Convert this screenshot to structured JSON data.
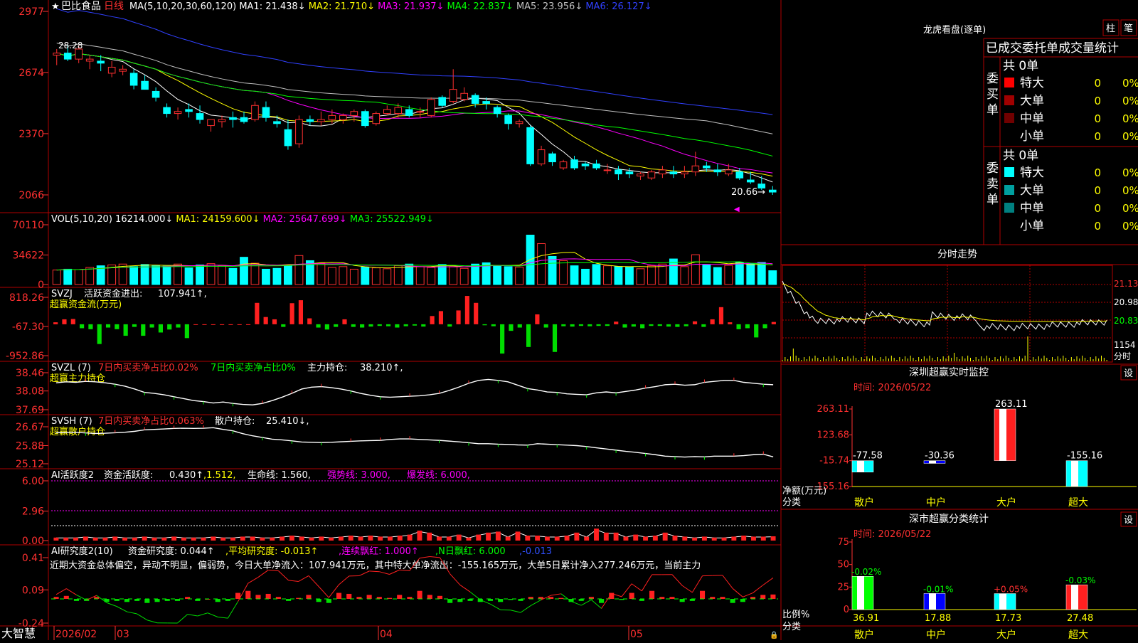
{
  "app": {
    "brand": "大智慧"
  },
  "chart_data": [
    {
      "type": "candlestick",
      "title": "巴比食品",
      "period": "日线",
      "ma_formula": "MA(5,10,20,30,60,120)",
      "ma_values": [
        {
          "label": "MA1:",
          "value": "21.438↓",
          "color": "#ffffff"
        },
        {
          "label": "MA2:",
          "value": "21.710↓",
          "color": "#ffff00"
        },
        {
          "label": "MA3:",
          "value": "21.937↓",
          "color": "#ff00ff"
        },
        {
          "label": "MA4:",
          "value": "22.837↓",
          "color": "#00ff00"
        },
        {
          "label": "MA5:",
          "value": "23.956↓",
          "color": "#c0c0c0"
        },
        {
          "label": "MA6:",
          "value": "26.127↓",
          "color": "#3040ff"
        }
      ],
      "y_ticks": [
        "2977",
        "2674",
        "2370",
        "2066"
      ],
      "ylim": [
        20.66,
        29.77
      ],
      "annotations": {
        "high": "28.28",
        "low": "20.66→"
      },
      "x_labels": [
        "2026/02",
        "03",
        "04",
        "05"
      ],
      "candles": [
        [
          27.6,
          27.9,
          27.1,
          27.7
        ],
        [
          27.7,
          28.1,
          27.3,
          27.4
        ],
        [
          27.4,
          28.1,
          27.2,
          27.9
        ],
        [
          27.3,
          27.6,
          26.9,
          27.4
        ],
        [
          27.3,
          27.6,
          26.8,
          27.2
        ],
        [
          26.7,
          27.3,
          26.5,
          27.0
        ],
        [
          26.8,
          27.1,
          26.6,
          26.9
        ],
        [
          26.7,
          26.9,
          25.9,
          26.1
        ],
        [
          26.3,
          26.6,
          25.9,
          25.9
        ],
        [
          25.8,
          26.0,
          25.3,
          25.5
        ],
        [
          25.0,
          25.2,
          24.5,
          24.7
        ],
        [
          24.7,
          25.0,
          24.4,
          24.8
        ],
        [
          24.9,
          25.2,
          24.5,
          24.8
        ],
        [
          24.7,
          25.1,
          24.2,
          24.4
        ],
        [
          24.1,
          24.4,
          23.8,
          24.4
        ],
        [
          24.3,
          24.6,
          24.0,
          24.4
        ],
        [
          24.5,
          24.8,
          24.0,
          24.4
        ],
        [
          24.5,
          24.8,
          24.2,
          24.3
        ],
        [
          24.4,
          25.3,
          24.3,
          25.1
        ],
        [
          25.0,
          25.3,
          24.3,
          24.5
        ],
        [
          24.3,
          24.6,
          24.0,
          24.2
        ],
        [
          23.9,
          24.4,
          22.9,
          23.1
        ],
        [
          23.2,
          24.6,
          23.0,
          24.4
        ],
        [
          24.4,
          24.6,
          24.1,
          24.3
        ],
        [
          24.3,
          24.8,
          24.1,
          24.4
        ],
        [
          24.4,
          24.9,
          24.2,
          24.6
        ],
        [
          24.4,
          24.7,
          24.2,
          24.6
        ],
        [
          24.6,
          24.9,
          24.3,
          24.8
        ],
        [
          24.8,
          24.9,
          24.0,
          24.1
        ],
        [
          24.2,
          24.8,
          24.1,
          24.7
        ],
        [
          24.7,
          25.1,
          24.6,
          24.9
        ],
        [
          24.7,
          25.2,
          24.5,
          25.0
        ],
        [
          24.9,
          25.1,
          24.5,
          24.6
        ],
        [
          24.8,
          25.0,
          24.5,
          24.8
        ],
        [
          24.6,
          25.5,
          24.5,
          25.4
        ],
        [
          25.5,
          25.6,
          25.0,
          25.1
        ],
        [
          25.3,
          26.9,
          25.2,
          25.9
        ],
        [
          25.4,
          26.0,
          25.3,
          25.7
        ],
        [
          25.6,
          25.7,
          25.0,
          25.2
        ],
        [
          25.3,
          25.5,
          24.9,
          25.2
        ],
        [
          25.0,
          25.1,
          24.5,
          24.7
        ],
        [
          24.6,
          24.7,
          23.9,
          24.2
        ],
        [
          24.2,
          24.4,
          24.0,
          24.3
        ],
        [
          24.0,
          24.1,
          22.1,
          22.2
        ],
        [
          22.2,
          23.1,
          22.1,
          22.9
        ],
        [
          22.7,
          22.8,
          22.1,
          22.3
        ],
        [
          22.0,
          22.4,
          21.9,
          22.3
        ],
        [
          22.4,
          22.6,
          21.9,
          22.0
        ],
        [
          22.2,
          22.3,
          21.9,
          22.1
        ],
        [
          22.2,
          22.4,
          21.9,
          22.0
        ],
        [
          21.9,
          22.2,
          21.7,
          21.9
        ],
        [
          21.9,
          22.1,
          21.4,
          21.7
        ],
        [
          21.8,
          22.0,
          21.5,
          21.7
        ],
        [
          21.6,
          21.8,
          21.4,
          21.7
        ],
        [
          21.5,
          21.9,
          21.4,
          21.8
        ],
        [
          21.7,
          22.1,
          21.5,
          21.9
        ],
        [
          21.8,
          22.1,
          21.5,
          21.7
        ],
        [
          21.7,
          22.1,
          21.5,
          21.8
        ],
        [
          21.8,
          22.8,
          21.6,
          22.1
        ],
        [
          22.1,
          22.3,
          21.8,
          22.0
        ],
        [
          21.9,
          22.2,
          21.6,
          21.8
        ],
        [
          21.7,
          22.2,
          21.6,
          21.9
        ],
        [
          21.8,
          22.0,
          21.4,
          21.5
        ],
        [
          21.4,
          21.8,
          21.2,
          21.3
        ],
        [
          21.2,
          21.6,
          20.9,
          21.0
        ],
        [
          20.9,
          21.1,
          20.66,
          20.8
        ]
      ]
    },
    {
      "type": "bar",
      "title": "VOL(5,10,20)",
      "values_text": [
        {
          "label": "",
          "value": "16214.000↓",
          "color": "#ffffff"
        },
        {
          "label": "MA1:",
          "value": "24159.600↓",
          "color": "#ffff00"
        },
        {
          "label": "MA2:",
          "value": "25647.699↓",
          "color": "#ff00ff"
        },
        {
          "label": "MA3:",
          "value": "25522.949↓",
          "color": "#00ff00"
        }
      ],
      "y_ticks": [
        "70110",
        "34622",
        "0"
      ],
      "ylim": [
        0,
        70110
      ],
      "values": [
        17000,
        18000,
        17500,
        20000,
        22000,
        23000,
        24000,
        21000,
        23500,
        22000,
        21500,
        24000,
        19500,
        23000,
        24500,
        22000,
        19000,
        32000,
        25000,
        18000,
        19000,
        22500,
        34000,
        28000,
        25000,
        20000,
        21000,
        18000,
        20500,
        19500,
        18500,
        22000,
        24000,
        21000,
        20000,
        23500,
        21000,
        19000,
        24000,
        25500,
        22000,
        21000,
        20500,
        58000,
        48000,
        33000,
        28000,
        22000,
        18000,
        23500,
        22000,
        21000,
        20500,
        18500,
        22000,
        24000,
        30000,
        21000,
        35000,
        23000,
        20000,
        22500,
        26000,
        24500,
        26000,
        16214
      ],
      "up_down": "per-candle"
    },
    {
      "type": "bar",
      "title": "SVZJ",
      "label_text": "活跃资金进出:",
      "value_text": "107.941↑,",
      "sub_label": "超赢资金流(万元)",
      "y_ticks": [
        "818.26",
        "-67.30",
        "-952.86"
      ],
      "ylim": [
        -952.86,
        818.26
      ],
      "values": [
        60,
        150,
        160,
        -120,
        -150,
        -600,
        -100,
        -150,
        -350,
        -80,
        -350,
        -100,
        -250,
        -160,
        -100,
        -420,
        0,
        0,
        0,
        0,
        0,
        0,
        0,
        650,
        220,
        150,
        -80,
        640,
        730,
        180,
        -100,
        -160,
        -80,
        150,
        -80,
        -100,
        -70,
        -50,
        -60,
        -100,
        -60,
        -40,
        -70,
        250,
        400,
        -70,
        420,
        860,
        650,
        -30,
        -60,
        -890,
        -200,
        -100,
        -690,
        300,
        -100,
        -840,
        -60,
        -70,
        -50,
        -60,
        -50,
        -50,
        80,
        -100,
        -70,
        -120,
        -50,
        -50,
        -70,
        -80,
        -60,
        90,
        -80,
        150,
        520,
        60,
        -150,
        -120,
        -400,
        -120,
        70
      ]
    },
    {
      "type": "line",
      "title": "SVZL (7)",
      "label_text": "7日内买卖净占比0.02%",
      "label_text2": "7日内买卖净占比0%",
      "value_label": "主力持仓:",
      "value_text": "38.210↑,",
      "sub_label": "超赢主力持仓",
      "y_ticks": [
        "38.46",
        "38.08",
        "37.69"
      ],
      "ylim": [
        37.69,
        38.46
      ],
      "values": [
        38.25,
        38.27,
        38.26,
        38.28,
        38.27,
        38.25,
        38.22,
        38.18,
        38.12,
        38.05,
        38.03,
        38.0,
        37.96,
        37.92,
        37.88,
        37.86,
        37.83,
        37.85,
        37.82,
        37.8,
        37.79,
        37.82,
        37.88,
        37.95,
        38.03,
        38.12,
        38.16,
        38.17,
        38.15,
        38.12,
        38.08,
        38.03,
        37.99,
        37.96,
        37.95,
        37.96,
        37.97,
        37.98,
        38.0,
        38.03,
        38.09,
        38.16,
        38.24,
        38.3,
        38.32,
        38.3,
        38.27,
        38.2,
        38.13,
        38.1,
        38.06,
        38.05,
        38.02,
        38.01,
        38.0,
        38.04,
        38.06,
        38.04,
        38.07,
        38.1,
        38.14,
        38.17,
        38.21,
        38.22,
        38.2,
        38.21,
        38.26,
        38.28,
        38.3,
        38.3,
        38.26,
        38.24,
        38.22,
        38.21
      ]
    },
    {
      "type": "line",
      "title": "SVSH (7)",
      "label_text": "7日内买卖净占比0.063%",
      "value_label": "散户持仓:",
      "value_text": "25.410↓,",
      "sub_label": "超赢散户持仓",
      "y_ticks": [
        "26.67",
        "25.88",
        "25.12"
      ],
      "ylim": [
        25.12,
        26.67
      ],
      "values": [
        26.42,
        26.43,
        26.44,
        26.41,
        26.39,
        26.4,
        26.42,
        26.44,
        26.48,
        26.54,
        26.56,
        26.58,
        26.6,
        26.61,
        26.6,
        26.61,
        26.63,
        26.56,
        26.5,
        26.38,
        26.29,
        26.22,
        26.15,
        26.12,
        26.08,
        26.03,
        26.02,
        26.01,
        26.02,
        26.04,
        26.06,
        26.08,
        26.09,
        26.1,
        26.14,
        26.16,
        26.16,
        26.14,
        26.12,
        26.1,
        26.07,
        26.04,
        26.0,
        25.96,
        25.96,
        25.94,
        25.93,
        25.91,
        25.9,
        25.96,
        25.94,
        25.92,
        25.9,
        25.88,
        25.84,
        25.79,
        25.74,
        25.69,
        25.64,
        25.6,
        25.55,
        25.5,
        25.44,
        25.42,
        25.4,
        25.42,
        25.41,
        25.44,
        25.44,
        25.44,
        25.46,
        25.5,
        25.52,
        25.41
      ]
    },
    {
      "type": "bar",
      "title": "AI活跃度2",
      "label_text": "资金活跃度:",
      "value_text": "0.430↑",
      "extra": [
        {
          "text": ",1.512,",
          "color": "#ffff00"
        },
        {
          "text": "生命线: 1.560,",
          "color": "#ffffff"
        },
        {
          "text": "强势线: 3.000,",
          "color": "#ff00ff"
        },
        {
          "text": "爆发线: 6.000,",
          "color": "#ff00ff"
        }
      ],
      "y_ticks": [
        "6.00",
        "2.96",
        "0.00"
      ],
      "ylim": [
        0,
        6.0
      ],
      "values": [
        0.3,
        0.3,
        0.3,
        0.4,
        0.3,
        0.3,
        0.4,
        0.3,
        0.3,
        0.4,
        0.3,
        0.3,
        0.4,
        0.3,
        0.3,
        0.3,
        0.4,
        0.3,
        0.3,
        0.4,
        0.4,
        0.3,
        0.3,
        0.4,
        0.5,
        0.4,
        0.3,
        0.4,
        0.3,
        0.4,
        0.5,
        0.4,
        0.5,
        0.4,
        0.4,
        0.5,
        0.6,
        1.0,
        0.8,
        0.4,
        0.4,
        0.6,
        0.3,
        0.6,
        0.8,
        0.9,
        0.4,
        0.9,
        0.5,
        0.5,
        0.4,
        0.4,
        0.5,
        0.8,
        0.4,
        1.2,
        0.8,
        0.8,
        0.4,
        0.6,
        0.4,
        0.5,
        0.8,
        0.5,
        0.4,
        0.3,
        0.4,
        0.3,
        0.3,
        0.4,
        0.5,
        0.4,
        0.4,
        0.43
      ]
    },
    {
      "type": "bar",
      "title": "AI研究度2(10)",
      "label_text": "资金研究度: 0.044↑",
      "extra": [
        {
          "text": ",平均研究度: -0.013↑",
          "color": "#ffff00"
        },
        {
          "text": ",连续飘红: 1.000↑",
          "color": "#ff00ff"
        },
        {
          "text": ",N日飘红: 6.000",
          "color": "#00ff00"
        },
        {
          "text": ",-0.013",
          "color": "#3050ff"
        }
      ],
      "comment": "近期大资金总体偏空，异动不明显，偏弱势，今日大单净流入：107.941万元，其中特大单净流出：-155.165万元，大单5日累计净入277.246万元，当前主力",
      "y_ticks": [
        "0.41",
        "0.09",
        "-0.24"
      ],
      "ylim": [
        -0.24,
        0.41
      ],
      "values": [
        0.02,
        0.03,
        -0.02,
        -0.02,
        0.02,
        -0.03,
        -0.02,
        -0.03,
        -0.02,
        -0.04,
        -0.03,
        -0.02,
        -0.02,
        0.02,
        -0.02,
        0.0,
        -0.03,
        -0.02,
        0.06,
        0.08,
        0.04,
        0.05,
        0.02,
        -0.02,
        0.01,
        0.04,
        -0.03,
        -0.04,
        0.06,
        0.05,
        0.02,
        0.04,
        0.02,
        0.01,
        0.04,
        0.02,
        0.08,
        0.04,
        0.03,
        -0.04,
        -0.03,
        -0.02,
        -0.03,
        -0.02,
        -0.03,
        -0.01,
        -0.02,
        0.02,
        0.02,
        0.02,
        0.01,
        -0.03,
        -0.02,
        0.02,
        -0.04,
        0.06,
        -0.01,
        0.06,
        -0.02,
        0.08,
        0.02,
        0.02,
        -0.03,
        -0.02,
        0.08,
        0.02,
        0.02,
        -0.04,
        -0.03,
        0.02,
        0.04,
        0.044
      ]
    },
    {
      "type": "bar",
      "title": "深圳超赢实时监控",
      "time_label": "时间: 2026/05/22",
      "y_ticks": [
        "263.11",
        "123.68",
        "-15.74",
        "-155.16"
      ],
      "ylim": [
        -155.16,
        263.11
      ],
      "categories": [
        "散户",
        "中户",
        "大户",
        "超大"
      ],
      "values": [
        -77.58,
        -30.36,
        263.11,
        -155.16
      ],
      "value_labels": [
        "-77.58",
        "-30.36",
        "263.11",
        "-155.16"
      ],
      "y_axis_label": "净额(万元)",
      "x_axis_label": "分类"
    },
    {
      "type": "bar",
      "title": "深市超赢分类统计",
      "time_label": "时间: 2026/05/22",
      "y_ticks": [
        "75",
        "50",
        "25",
        "0"
      ],
      "ylim": [
        0,
        75
      ],
      "categories": [
        "散户",
        "中户",
        "大户",
        "超大"
      ],
      "values": [
        36.91,
        17.88,
        17.73,
        27.48
      ],
      "value_labels": [
        "36.91",
        "17.88",
        "17.73",
        "27.48"
      ],
      "change_labels": [
        "-0.02%",
        "-0.01%",
        "+0.05%",
        "-0.03%"
      ],
      "y_axis_label": "比例%",
      "x_axis_label": "分类"
    }
  ],
  "longhu": {
    "title": "龙虎看盘(逐单)",
    "tab_bars": "柱",
    "tab_ticks": "笔",
    "header": "已成交委托单成交量统计",
    "buy_side_label": "委买单",
    "sell_side_label": "委卖单",
    "buy_total": "共 0单",
    "sell_total": "共 0单",
    "buy_rows": [
      {
        "name": "特大",
        "count": "0",
        "pct": "0%",
        "color": "#ff0000"
      },
      {
        "name": "大单",
        "count": "0",
        "pct": "0%",
        "color": "#a00000"
      },
      {
        "name": "中单",
        "count": "0",
        "pct": "0%",
        "color": "#700000"
      },
      {
        "name": "小单",
        "count": "0",
        "pct": "0%",
        "color": ""
      }
    ],
    "sell_rows": [
      {
        "name": "特大",
        "count": "0",
        "pct": "0%",
        "color": "#00ffff"
      },
      {
        "name": "大单",
        "count": "0",
        "pct": "0%",
        "color": "#00a0a0"
      },
      {
        "name": "中单",
        "count": "0",
        "pct": "0%",
        "color": "#008080"
      },
      {
        "name": "小单",
        "count": "0",
        "pct": "0%",
        "color": ""
      }
    ]
  },
  "intraday": {
    "title": "分时走势",
    "y_ticks": [
      "21.13",
      "20.98",
      "20.83"
    ],
    "vol_label": "1154",
    "vol_sub": "分时"
  },
  "settings_label": "设"
}
